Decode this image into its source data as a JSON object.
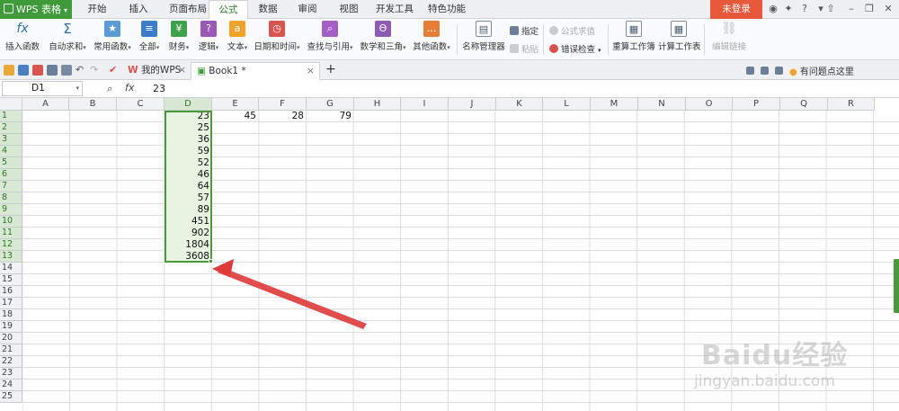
{
  "app": {
    "name": "WPS 表格",
    "caret": "▾"
  },
  "menu": {
    "tabs": [
      "开始",
      "插入",
      "页面布局",
      "公式",
      "数据",
      "审阅",
      "视图",
      "开发工具",
      "特色功能"
    ],
    "active": "公式",
    "login": "未登录"
  },
  "ribbon": {
    "insert_function": "插入函数",
    "autosum": "自动求和",
    "common_funcs": "常用函数",
    "all": "全部",
    "finance": "财务",
    "logic": "逻辑",
    "text": "文本",
    "datetime": "日期和时间",
    "lookup": "查找与引用",
    "math": "数学和三角",
    "other": "其他函数",
    "name_manager": "名称管理器",
    "specify": "指定",
    "paste": "粘贴",
    "evaluate": "公式求值",
    "error_check": "错误检查",
    "recalc_workbook": "重算工作簿",
    "calc_sheet": "计算工作表",
    "edit_links": "编辑链接",
    "fx_glyph": "fx",
    "sigma_glyph": "Σ"
  },
  "tabs": {
    "my_wps": "我的WPS",
    "book": "Book1 *",
    "close": "×",
    "add": "+",
    "help": "有问题点这里"
  },
  "formula_bar": {
    "name_box": "D1",
    "fx": "fx",
    "value": "23"
  },
  "columns": [
    "A",
    "B",
    "C",
    "D",
    "E",
    "F",
    "G",
    "H",
    "I",
    "J",
    "K",
    "L",
    "M",
    "N",
    "O",
    "P",
    "Q",
    "R"
  ],
  "rows": [
    "1",
    "2",
    "3",
    "4",
    "5",
    "6",
    "7",
    "8",
    "9",
    "10",
    "11",
    "12",
    "13",
    "14",
    "15",
    "16",
    "17",
    "18",
    "19",
    "20",
    "21",
    "22",
    "23",
    "24",
    "25"
  ],
  "selected_column": "D",
  "cells": {
    "D": [
      "23",
      "25",
      "36",
      "59",
      "52",
      "46",
      "64",
      "57",
      "89",
      "451",
      "902",
      "1804",
      "3608"
    ],
    "E1": "45",
    "F1": "28",
    "G1": "79"
  },
  "watermark": {
    "main": "Baidu经验",
    "sub": "jingyan.baidu.com"
  },
  "colors": {
    "accent_green": "#3f9a3a",
    "login_red": "#e8583b",
    "arrow_red": "#e0393a"
  }
}
